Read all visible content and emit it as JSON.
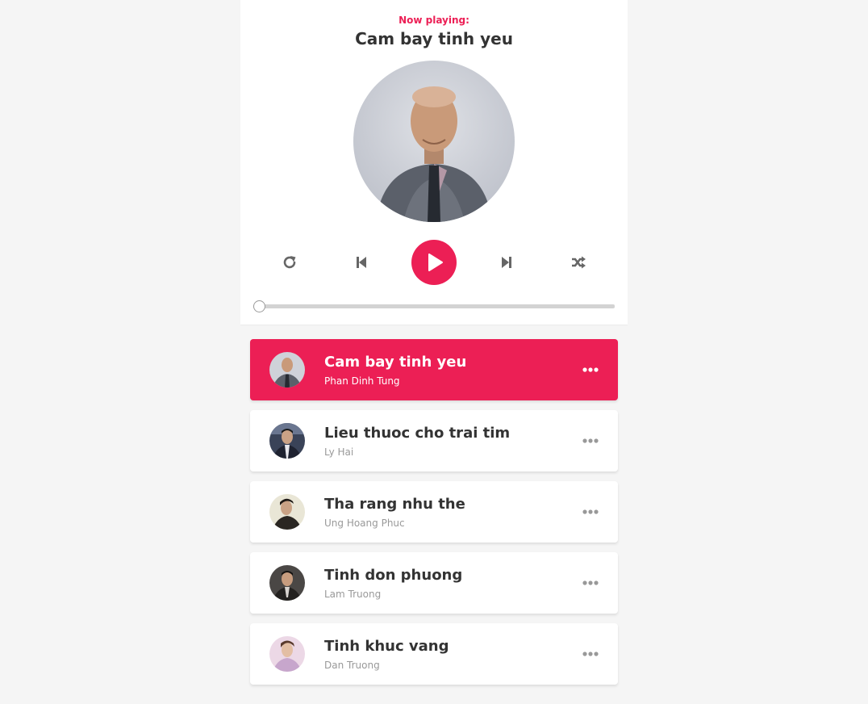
{
  "header": {
    "now_playing_label": "Now playing:",
    "current_title": "Cam bay tinh yeu"
  },
  "controls": {
    "icons": [
      "repeat-icon",
      "skip-back-icon",
      "play-icon",
      "skip-forward-icon",
      "shuffle-icon"
    ]
  },
  "progress": {
    "value_percent": 0
  },
  "playlist": [
    {
      "title": "Cam bay tinh yeu",
      "author": "Phan Dinh Tung",
      "active": true
    },
    {
      "title": "Lieu thuoc cho trai tim",
      "author": "Ly Hai",
      "active": false
    },
    {
      "title": "Tha rang nhu the",
      "author": "Ung Hoang Phuc",
      "active": false
    },
    {
      "title": "Tinh don phuong",
      "author": "Lam Truong",
      "active": false
    },
    {
      "title": "Tinh khuc vang",
      "author": "Dan Truong",
      "active": false
    }
  ],
  "colors": {
    "accent": "#ec1f55",
    "background": "#f5f5f5",
    "text": "#333333",
    "muted": "#999999"
  }
}
